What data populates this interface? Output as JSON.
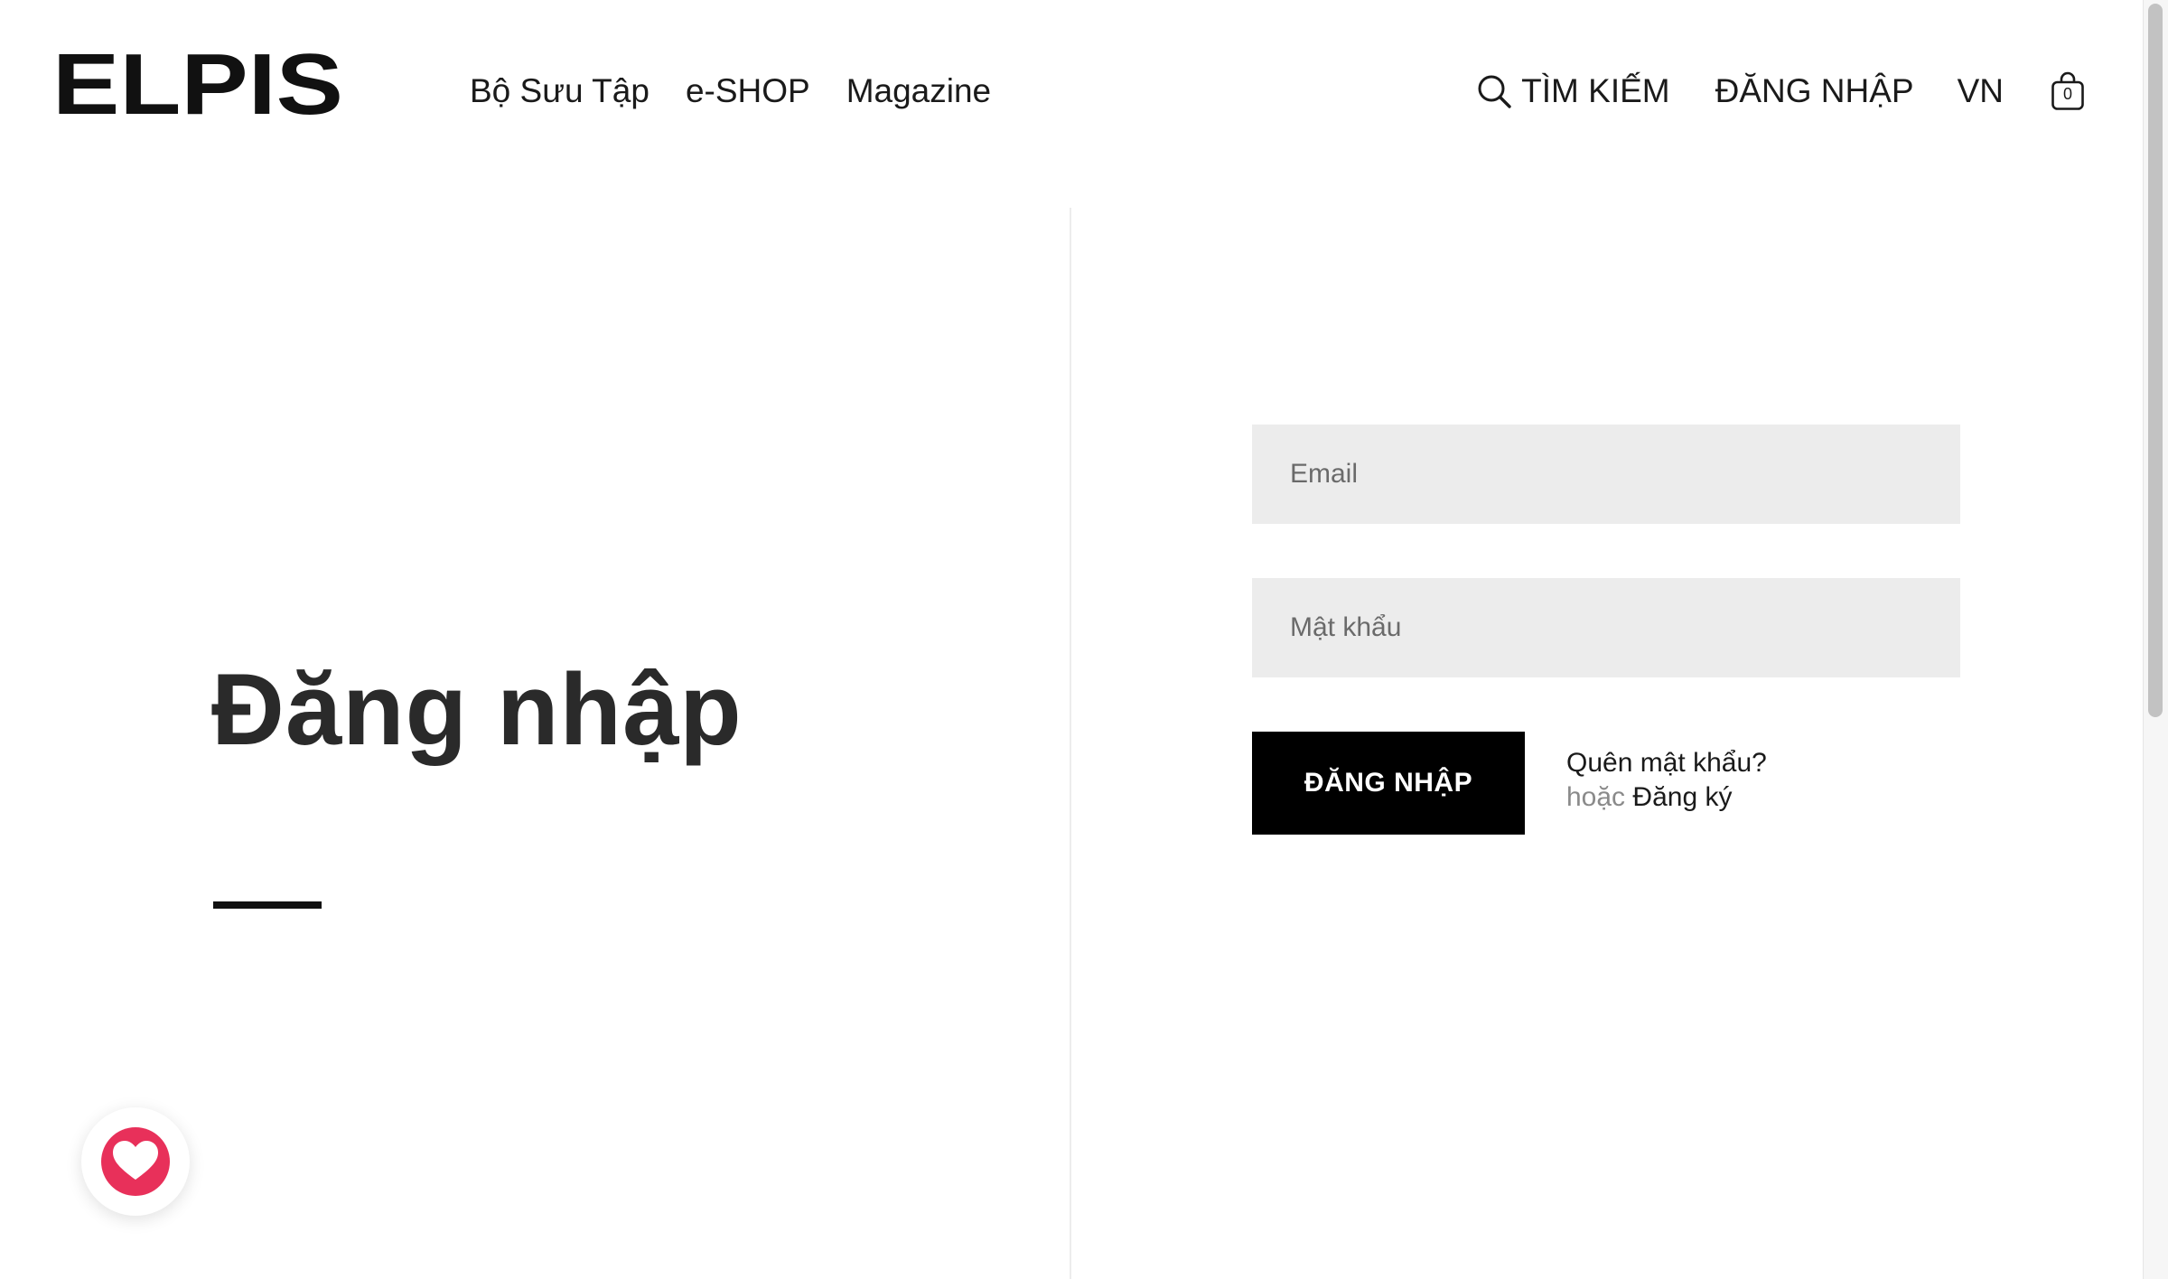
{
  "brand": {
    "logo_text": "ELPIS"
  },
  "header": {
    "nav": [
      {
        "label": "Bộ Sưu Tập"
      },
      {
        "label": "e-SHOP"
      },
      {
        "label": "Magazine"
      }
    ],
    "search_label": "TÌM KIẾM",
    "login_label": "ĐĂNG NHẬP",
    "language": "VN",
    "cart_count": "0"
  },
  "page": {
    "title": "Đăng nhập"
  },
  "form": {
    "email_placeholder": "Email",
    "email_value": "",
    "password_placeholder": "Mật khẩu",
    "password_value": "",
    "submit_label": "ĐĂNG NHẬP",
    "forgot_password": "Quên mật khẩu?",
    "or_text": "hoặc",
    "register_link": "Đăng ký"
  },
  "icons": {
    "search": "search-icon",
    "cart": "shopping-bag-icon",
    "wishlist": "heart-icon"
  },
  "colors": {
    "accent": "#e8305a",
    "button_bg": "#000000",
    "field_bg": "#ececec"
  }
}
